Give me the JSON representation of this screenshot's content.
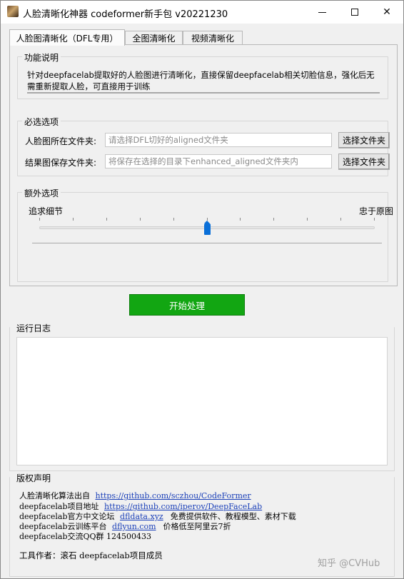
{
  "window": {
    "title": "人脸清晰化神器 codeformer新手包 v20221230",
    "controls": {
      "minimize": "",
      "maximize": "",
      "close": "✕"
    }
  },
  "tabs": [
    {
      "label": "人脸图清晰化（DFL专用）",
      "active": true
    },
    {
      "label": "全图清晰化",
      "active": false
    },
    {
      "label": "视频清晰化",
      "active": false
    }
  ],
  "description": {
    "title": "功能说明",
    "text": "针对deepfacelab提取好的人脸图进行清晰化，直接保留deepfacelab相关切脸信息，强化后无需重新提取人脸，可直接用于训练"
  },
  "required": {
    "title": "必选选项",
    "rows": [
      {
        "label": "人脸图所在文件夹:",
        "placeholder": "请选择DFL切好的aligned文件夹",
        "button": "选择文件夹"
      },
      {
        "label": "结果图保存文件夹:",
        "placeholder": "将保存在选择的目录下enhanced_aligned文件夹内",
        "button": "选择文件夹"
      }
    ]
  },
  "extra": {
    "title": "额外选项",
    "slider_left_label": "追求细节",
    "slider_right_label": "忠于原图",
    "slider_value": 0.5,
    "tick_count": 11
  },
  "start_button": "开始处理",
  "log": {
    "title": "运行日志",
    "content": ""
  },
  "copyright": {
    "title": "版权声明",
    "lines": [
      {
        "text": "人脸清晰化算法出自",
        "link": "https://github.com/sczhou/CodeFormer",
        "suffix": ""
      },
      {
        "text": "deepfacelab项目地址",
        "link": "https://github.com/iperov/DeepFaceLab",
        "suffix": ""
      },
      {
        "text": "deepfacelab官方中文论坛",
        "link": "dfldata.xyz",
        "suffix": "免费提供软件、教程模型、素材下载"
      },
      {
        "text": "deepfacelab云训练平台",
        "link": "dflyun.com",
        "suffix": "价格低至阿里云7折"
      },
      {
        "text": "deepfacelab交流QQ群 124500433",
        "link": "",
        "suffix": ""
      }
    ],
    "author": "工具作者：滚石 deepfacelab项目成员"
  },
  "watermark": "知乎 @CVHub",
  "colors": {
    "start_button": "#12a612",
    "slider_thumb": "#0a6fd8",
    "link": "#1a3fb8"
  }
}
